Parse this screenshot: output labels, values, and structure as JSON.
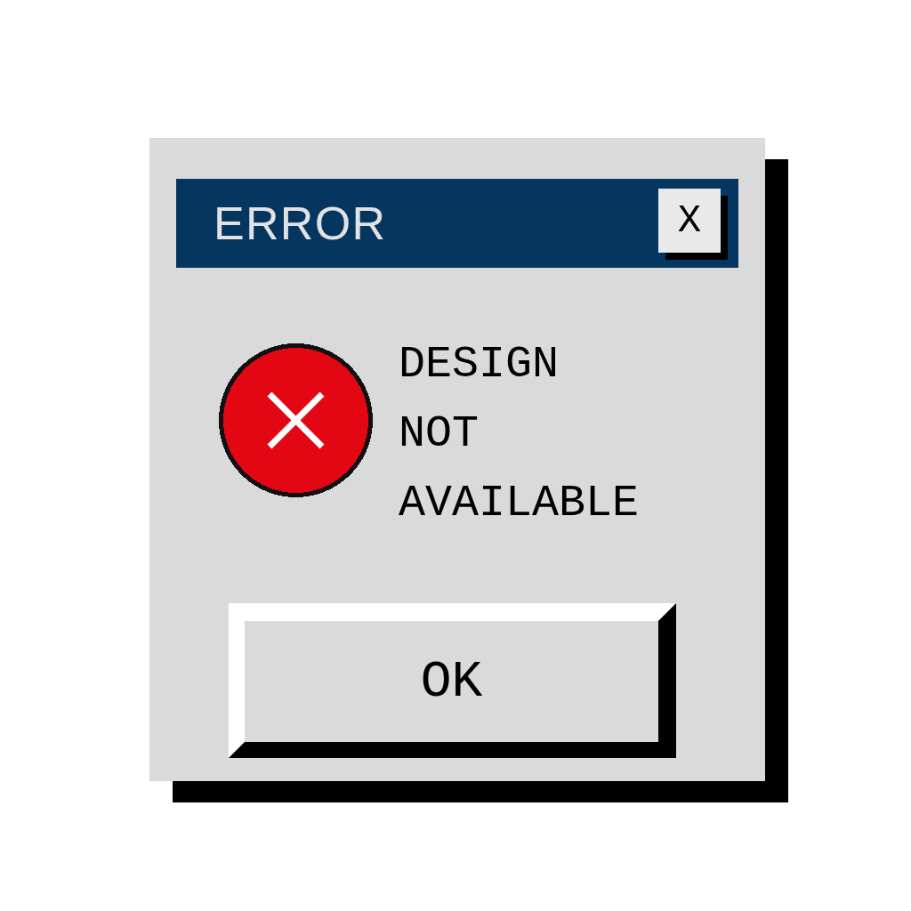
{
  "window": {
    "title": "ERROR",
    "close_label": "X"
  },
  "message_lines": [
    "DESIGN",
    "NOT",
    "AVAILABLE"
  ],
  "buttons": [
    {
      "label": "OK"
    }
  ]
}
